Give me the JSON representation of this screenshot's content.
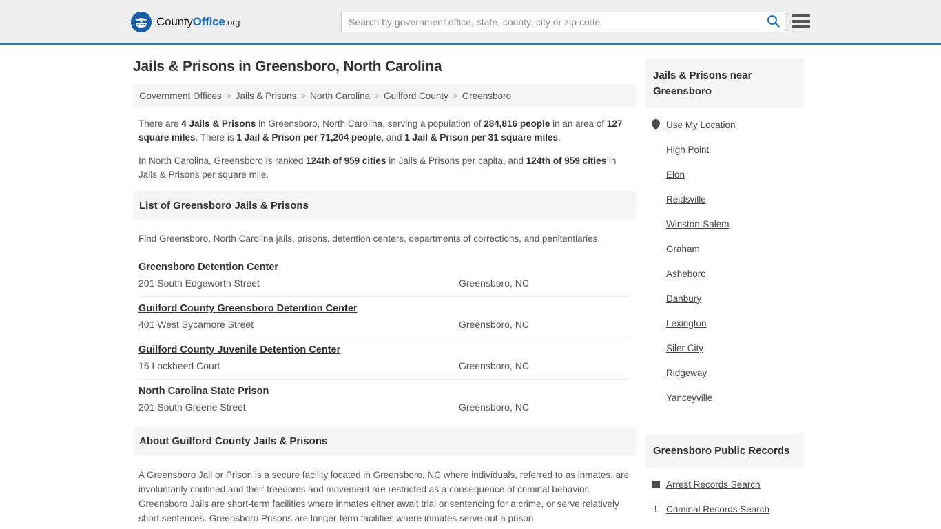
{
  "header": {
    "logo": {
      "icon": "eagle-shield-icon",
      "text_part1": "County",
      "text_part2": "Office",
      "text_part3": ".org"
    },
    "search": {
      "placeholder": "Search by government office, state, county, city or zip code",
      "value": "",
      "search_icon": "search-icon"
    },
    "menu_icon": "hamburger-menu-icon",
    "accent_color": "#35719e",
    "background_color": "#eeeeee"
  },
  "main": {
    "title": "Jails & Prisons in Greensboro, North Carolina",
    "breadcrumb": [
      "Government Offices",
      "Jails & Prisons",
      "North Carolina",
      "Guilford County",
      "Greensboro"
    ],
    "breadcrumb_separator": ">",
    "stats": {
      "paragraph1": [
        {
          "t": "There are ",
          "b": false
        },
        {
          "t": "4 Jails & Prisons",
          "b": true
        },
        {
          "t": " in Greensboro, North Carolina, serving a population of ",
          "b": false
        },
        {
          "t": "284,816 people",
          "b": true
        },
        {
          "t": " in an area of ",
          "b": false
        },
        {
          "t": "127 square miles",
          "b": true
        },
        {
          "t": ". There is ",
          "b": false
        },
        {
          "t": "1 Jail & Prison per 71,204 people",
          "b": true
        },
        {
          "t": ", and ",
          "b": false
        },
        {
          "t": "1 Jail & Prison per 31 square miles",
          "b": true
        },
        {
          "t": ".",
          "b": false
        }
      ],
      "paragraph2": [
        {
          "t": "In North Carolina, Greensboro is ranked ",
          "b": false
        },
        {
          "t": "124th of 959 cities",
          "b": true
        },
        {
          "t": " in Jails & Prisons per capita, and ",
          "b": false
        },
        {
          "t": "124th of 959 cities",
          "b": true
        },
        {
          "t": " in Jails & Prisons per square mile.",
          "b": false
        }
      ]
    },
    "list_section": {
      "heading": "List of Greensboro Jails & Prisons",
      "intro": "Find Greensboro, North Carolina jails, prisons, detention centers, departments of corrections, and penitentiaries.",
      "items": [
        {
          "name": "Greensboro Detention Center",
          "address": "201 South Edgeworth Street",
          "city": "Greensboro, NC"
        },
        {
          "name": "Guilford County Greensboro Detention Center",
          "address": "401 West Sycamore Street",
          "city": "Greensboro, NC"
        },
        {
          "name": "Guilford County Juvenile Detention Center",
          "address": "15 Lockheed Court",
          "city": "Greensboro, NC"
        },
        {
          "name": "North Carolina State Prison",
          "address": "201 South Greene Street",
          "city": "Greensboro, NC"
        }
      ]
    },
    "about_section": {
      "heading": "About Guilford County Jails & Prisons",
      "body": "A Greensboro Jail or Prison is a secure facility located in Greensboro, NC where individuals, referred to as inmates, are involuntarily confined and their freedoms and movement are restricted as a consequence of criminal behavior. Greensboro Jails are short-term facilities where inmates either await trial or sentencing for a crime, or serve relatively short sentences. Greensboro Prisons are longer-term facilities where inmates serve out a prison"
    }
  },
  "sidebar": {
    "nearby": {
      "heading": "Jails & Prisons near Greensboro",
      "items": [
        {
          "label": "Use My Location",
          "icon": "map-pin-icon"
        },
        {
          "label": "High Point",
          "icon": ""
        },
        {
          "label": "Elon",
          "icon": ""
        },
        {
          "label": "Reidsville",
          "icon": ""
        },
        {
          "label": "Winston-Salem",
          "icon": ""
        },
        {
          "label": "Graham",
          "icon": ""
        },
        {
          "label": "Asheboro",
          "icon": ""
        },
        {
          "label": "Danbury",
          "icon": ""
        },
        {
          "label": "Lexington",
          "icon": ""
        },
        {
          "label": "Siler City",
          "icon": ""
        },
        {
          "label": "Ridgeway",
          "icon": ""
        },
        {
          "label": "Yanceyville",
          "icon": ""
        }
      ]
    },
    "records": {
      "heading": "Greensboro Public Records",
      "items": [
        {
          "label": "Arrest Records Search",
          "icon": "fingerprint-square-icon"
        },
        {
          "label": "Criminal Records Search",
          "icon": "exclamation-icon"
        }
      ]
    }
  }
}
